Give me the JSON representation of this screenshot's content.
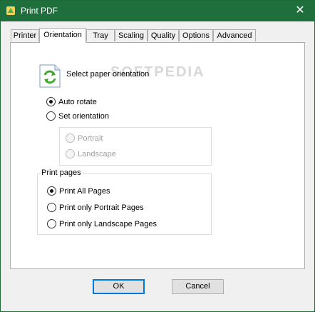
{
  "window": {
    "title": "Print PDF"
  },
  "tabs": [
    {
      "label": "Printer"
    },
    {
      "label": "Orientation"
    },
    {
      "label": "Tray"
    },
    {
      "label": "Scaling"
    },
    {
      "label": "Quality"
    },
    {
      "label": "Options"
    },
    {
      "label": "Advanced"
    }
  ],
  "active_tab": "Orientation",
  "orientation": {
    "heading": "Select paper orientation",
    "watermark": "SOFTPEDIA",
    "auto_rotate": {
      "label": "Auto rotate",
      "checked": true
    },
    "set_orientation": {
      "label": "Set orientation",
      "checked": false
    },
    "portrait": {
      "label": "Portrait",
      "enabled": false
    },
    "landscape": {
      "label": "Landscape",
      "enabled": false
    }
  },
  "print_pages": {
    "caption": "Print pages",
    "options": [
      {
        "label": "Print All Pages",
        "checked": true
      },
      {
        "label": "Print only Portrait Pages",
        "checked": false
      },
      {
        "label": "Print only Landscape Pages",
        "checked": false
      }
    ]
  },
  "buttons": {
    "ok": "OK",
    "cancel": "Cancel"
  },
  "colors": {
    "titlebar": "#1f6f3c",
    "focus": "#0078d7"
  }
}
